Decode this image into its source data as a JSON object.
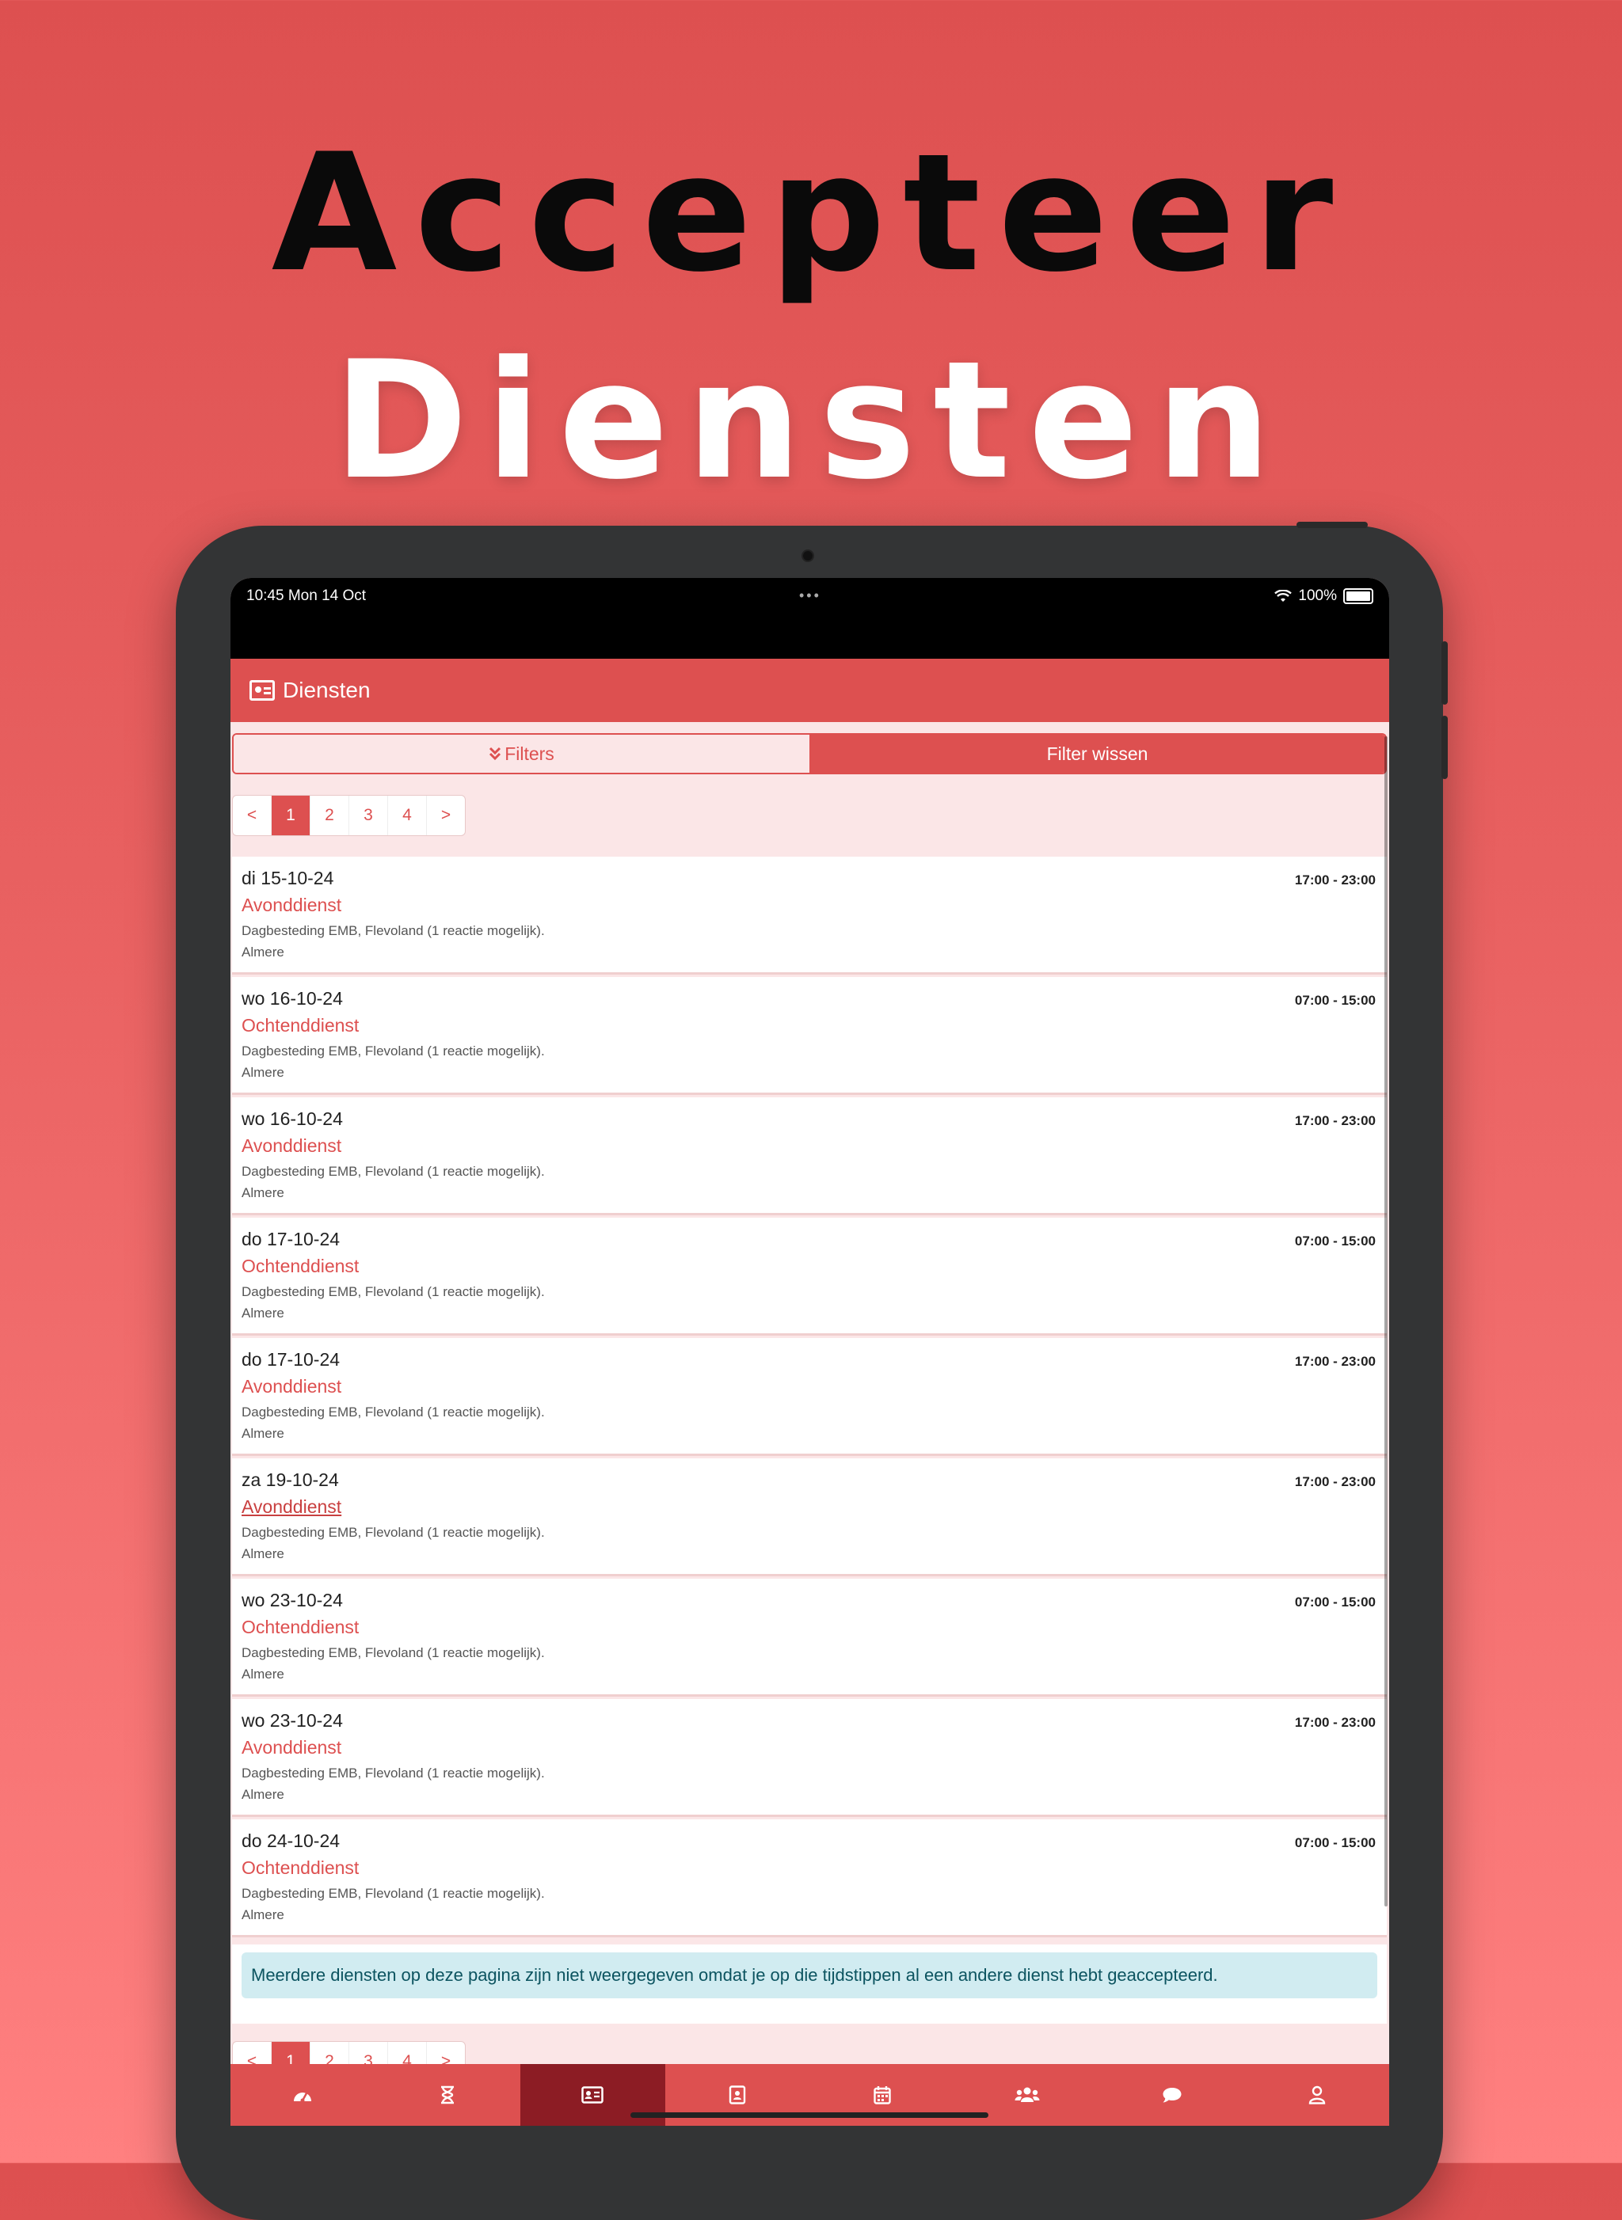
{
  "headline": {
    "line1": "Accepteer",
    "line2": "Diensten"
  },
  "statusbar": {
    "time": "10:45   Mon 14 Oct",
    "battery": "100%"
  },
  "appbar": {
    "title": "Diensten"
  },
  "filters": {
    "filters_label": "Filters",
    "clear_label": "Filter wissen"
  },
  "pager": {
    "prev": "<",
    "pages": [
      "1",
      "2",
      "3",
      "4"
    ],
    "next": ">",
    "active": "1"
  },
  "shifts": [
    {
      "date": "di 15-10-24",
      "time": "17:00 - 23:00",
      "type": "Avonddienst",
      "desc": "Dagbesteding EMB, Flevoland (1 reactie mogelijk).",
      "city": "Almere"
    },
    {
      "date": "wo 16-10-24",
      "time": "07:00 - 15:00",
      "type": "Ochtenddienst",
      "desc": "Dagbesteding EMB, Flevoland (1 reactie mogelijk).",
      "city": "Almere"
    },
    {
      "date": "wo 16-10-24",
      "time": "17:00 - 23:00",
      "type": "Avonddienst",
      "desc": "Dagbesteding EMB, Flevoland (1 reactie mogelijk).",
      "city": "Almere"
    },
    {
      "date": "do 17-10-24",
      "time": "07:00 - 15:00",
      "type": "Ochtenddienst",
      "desc": "Dagbesteding EMB, Flevoland (1 reactie mogelijk).",
      "city": "Almere"
    },
    {
      "date": "do 17-10-24",
      "time": "17:00 - 23:00",
      "type": "Avonddienst",
      "desc": "Dagbesteding EMB, Flevoland (1 reactie mogelijk).",
      "city": "Almere"
    },
    {
      "date": "za 19-10-24",
      "time": "17:00 - 23:00",
      "type": "Avonddienst",
      "desc": "Dagbesteding EMB, Flevoland (1 reactie mogelijk).",
      "city": "Almere"
    },
    {
      "date": "wo 23-10-24",
      "time": "07:00 - 15:00",
      "type": "Ochtenddienst",
      "desc": "Dagbesteding EMB, Flevoland (1 reactie mogelijk).",
      "city": "Almere"
    },
    {
      "date": "wo 23-10-24",
      "time": "17:00 - 23:00",
      "type": "Avonddienst",
      "desc": "Dagbesteding EMB, Flevoland (1 reactie mogelijk).",
      "city": "Almere"
    },
    {
      "date": "do 24-10-24",
      "time": "07:00 - 15:00",
      "type": "Ochtenddienst",
      "desc": "Dagbesteding EMB, Flevoland (1 reactie mogelijk).",
      "city": "Almere"
    }
  ],
  "notice": "Meerdere diensten op deze pagina zijn niet weergegeven omdat je op die tijdstippen al een andere dienst hebt geaccepteerd.",
  "bottomnav": [
    {
      "icon": "dashboard-icon"
    },
    {
      "icon": "hourglass-icon"
    },
    {
      "icon": "id-card-icon",
      "active": true
    },
    {
      "icon": "contact-book-icon"
    },
    {
      "icon": "calendar-icon"
    },
    {
      "icon": "users-icon"
    },
    {
      "icon": "chat-icon"
    },
    {
      "icon": "user-icon"
    }
  ],
  "colors": {
    "brand": "#dd5050",
    "active_tab": "#8c1c24",
    "notice_bg": "#d1ecf1",
    "notice_text": "#0c5460"
  }
}
